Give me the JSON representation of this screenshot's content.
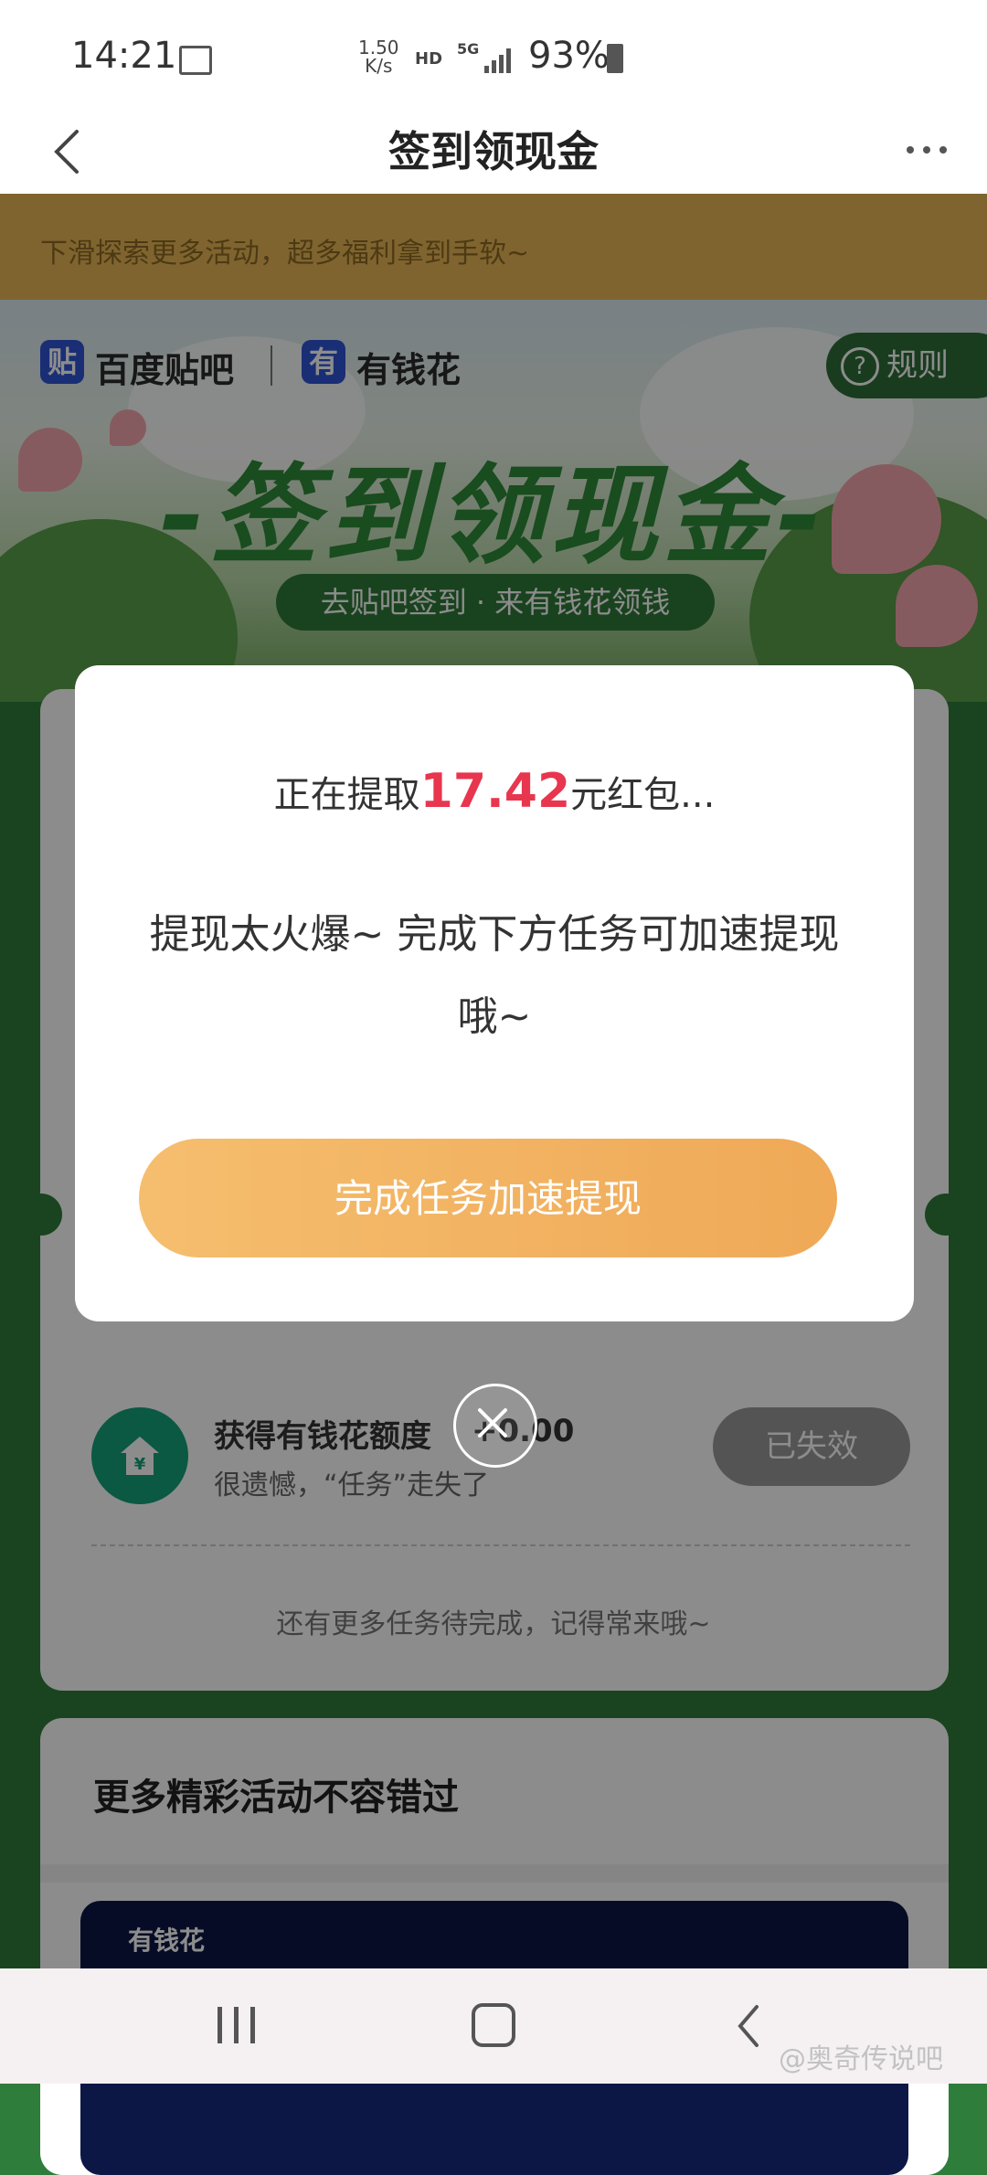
{
  "status_bar": {
    "time": "14:21",
    "net_speed_top": "1.50",
    "net_speed_bottom": "K/s",
    "hd": "HD",
    "network": "5G",
    "battery": "93%"
  },
  "nav": {
    "title": "签到领现金"
  },
  "tip_bar": {
    "text": "下滑探索更多活动，超多福利拿到手软~"
  },
  "banner": {
    "logo1_glyph": "贴",
    "logo1_name": "百度贴吧",
    "logo2_glyph": "有",
    "logo2_name": "有钱花",
    "rules_label": "规则",
    "headline": "-签到领现金-",
    "subtitle": "去贴吧签到 · 来有钱花领钱"
  },
  "task": {
    "title": "获得有钱花额度",
    "amount": "+0.00",
    "desc": "很遗憾，“任务”走失了",
    "status_label": "已失效"
  },
  "more_tasks_text": "还有更多任务待完成，记得常来哦~",
  "more_activities": {
    "heading": "更多精彩活动不容错过",
    "ad_logo": "有钱花"
  },
  "dialog": {
    "prefix": "正在提取",
    "amount": "17.42",
    "suffix": "元红包...",
    "message": "提现太火爆~ 完成下方任务可加速提现哦~",
    "cta_label": "完成任务加速提现"
  },
  "watermark": "@奥奇传说吧",
  "colors": {
    "accent_red": "#e8364e",
    "cta_orange": "#efa957",
    "tip_bg": "#e9b656",
    "page_green": "#2e7d3a"
  }
}
